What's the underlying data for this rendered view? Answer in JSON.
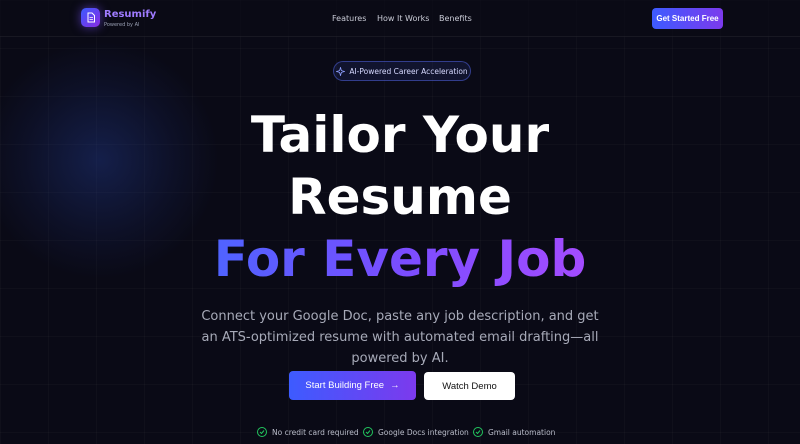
{
  "brand": {
    "name": "Resumify",
    "tagline": "Powered by AI"
  },
  "nav": {
    "links": [
      {
        "label": "Features"
      },
      {
        "label": "How It Works"
      },
      {
        "label": "Benefits"
      }
    ],
    "cta_label": "Get Started Free"
  },
  "hero": {
    "badge": "AI-Powered Career Acceleration",
    "title_line1": "Tailor Your",
    "title_line2": "Resume",
    "title_line3": "For Every Job",
    "subtitle": "Connect your Google Doc, paste any job description, and get an ATS-optimized resume with automated email drafting—all powered by AI.",
    "primary_button": "Start Building Free",
    "primary_arrow": "→",
    "secondary_button": "Watch Demo"
  },
  "features": [
    {
      "label": "No credit card required"
    },
    {
      "label": "Google Docs integration"
    },
    {
      "label": "Gmail automation"
    }
  ],
  "colors": {
    "background": "#0a0a16",
    "accent_blue": "#3d5bff",
    "accent_purple": "#7c3aed",
    "check_green": "#22c55e"
  }
}
